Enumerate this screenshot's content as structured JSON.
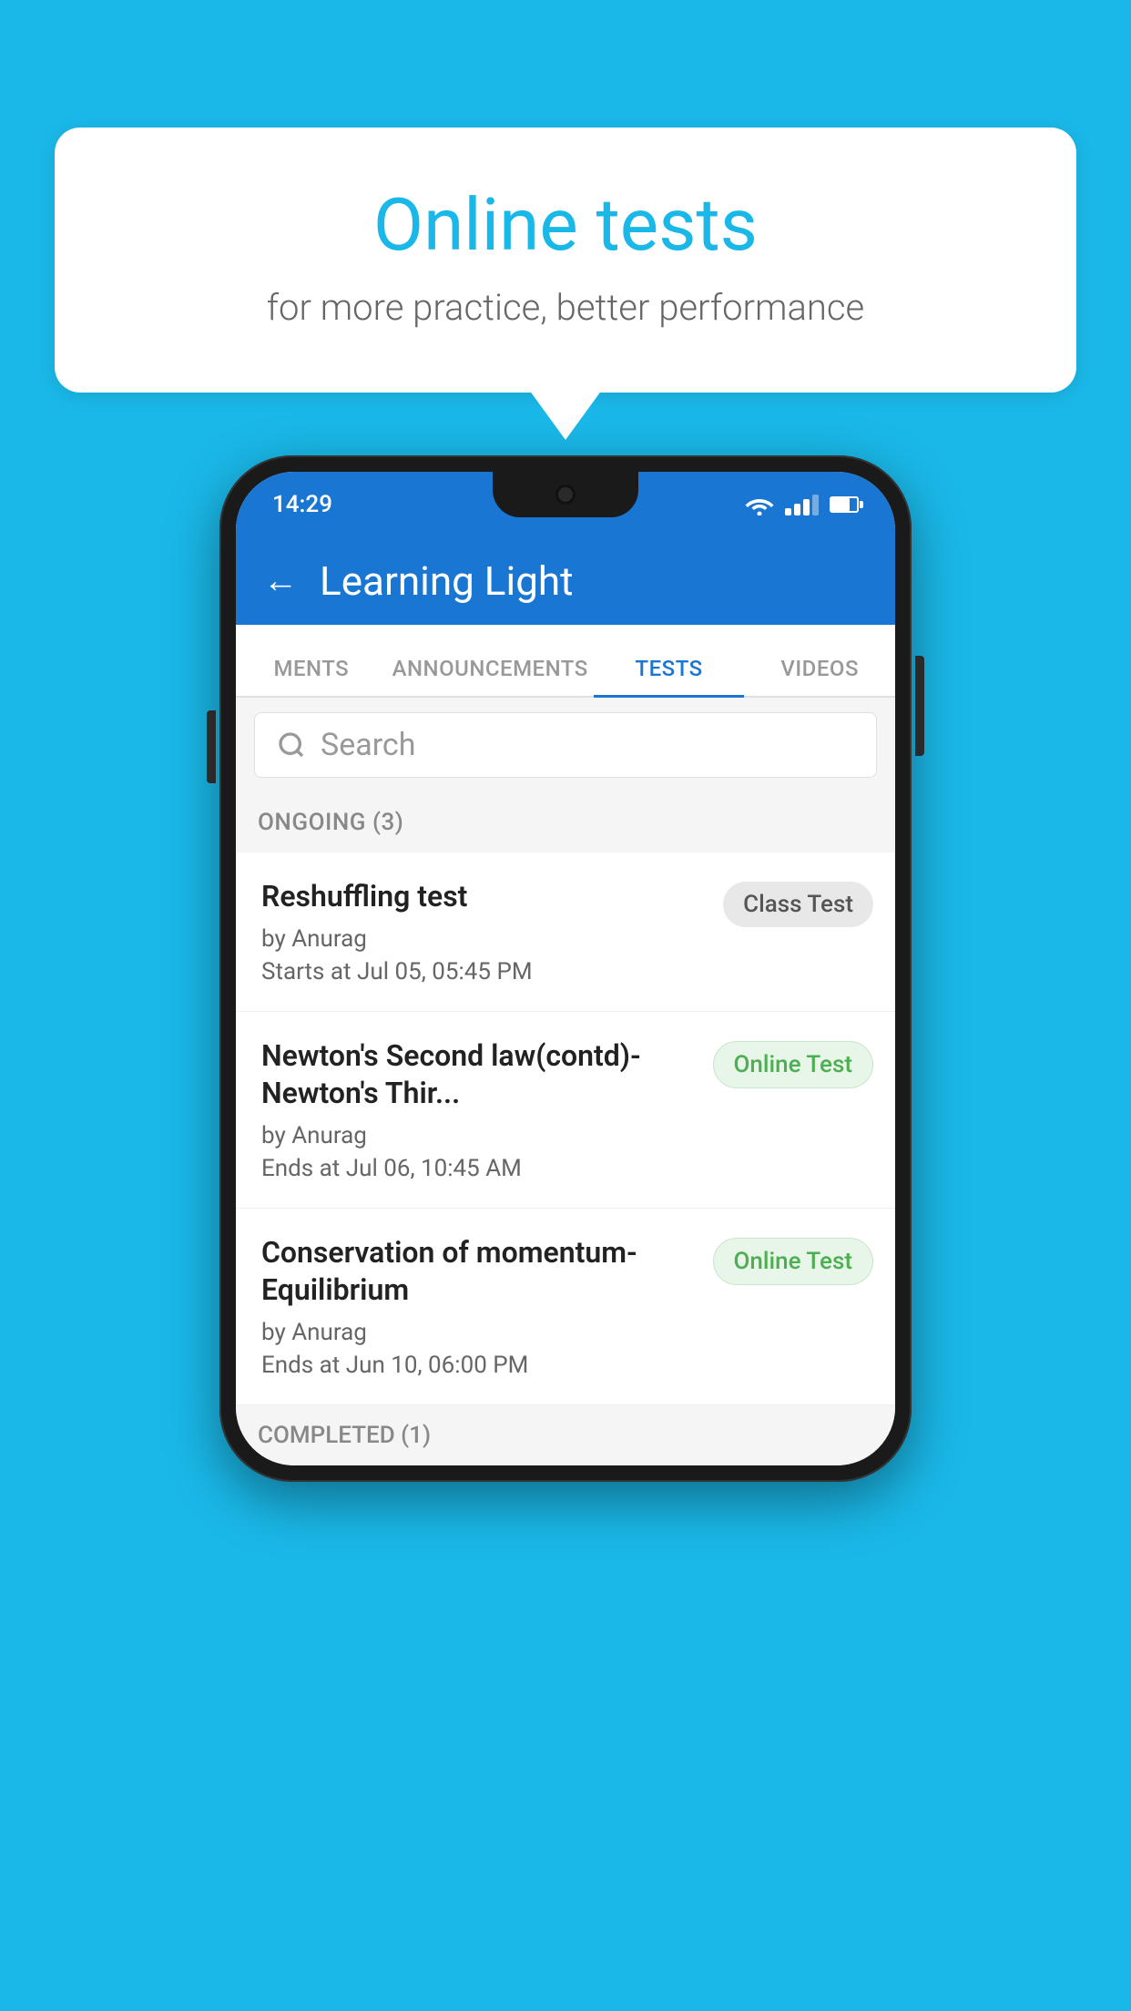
{
  "background_color": "#1ab8e8",
  "promo": {
    "title": "Online tests",
    "subtitle": "for more practice, better performance"
  },
  "phone": {
    "status_bar": {
      "time": "14:29"
    },
    "header": {
      "title": "Learning Light",
      "back_label": "←"
    },
    "tabs": [
      {
        "label": "MENTS",
        "active": false
      },
      {
        "label": "ANNOUNCEMENTS",
        "active": false
      },
      {
        "label": "TESTS",
        "active": true
      },
      {
        "label": "VIDEOS",
        "active": false
      }
    ],
    "search": {
      "placeholder": "Search"
    },
    "ongoing_section": {
      "label": "ONGOING (3)"
    },
    "tests": [
      {
        "name": "Reshuffling test",
        "author": "by Anurag",
        "time_label": "Starts at",
        "time": "Jul 05, 05:45 PM",
        "badge": "Class Test",
        "badge_type": "class"
      },
      {
        "name": "Newton's Second law(contd)-Newton's Thir...",
        "author": "by Anurag",
        "time_label": "Ends at",
        "time": "Jul 06, 10:45 AM",
        "badge": "Online Test",
        "badge_type": "online"
      },
      {
        "name": "Conservation of momentum-Equilibrium",
        "author": "by Anurag",
        "time_label": "Ends at",
        "time": "Jun 10, 06:00 PM",
        "badge": "Online Test",
        "badge_type": "online"
      }
    ],
    "completed_section": {
      "label": "COMPLETED (1)"
    }
  }
}
